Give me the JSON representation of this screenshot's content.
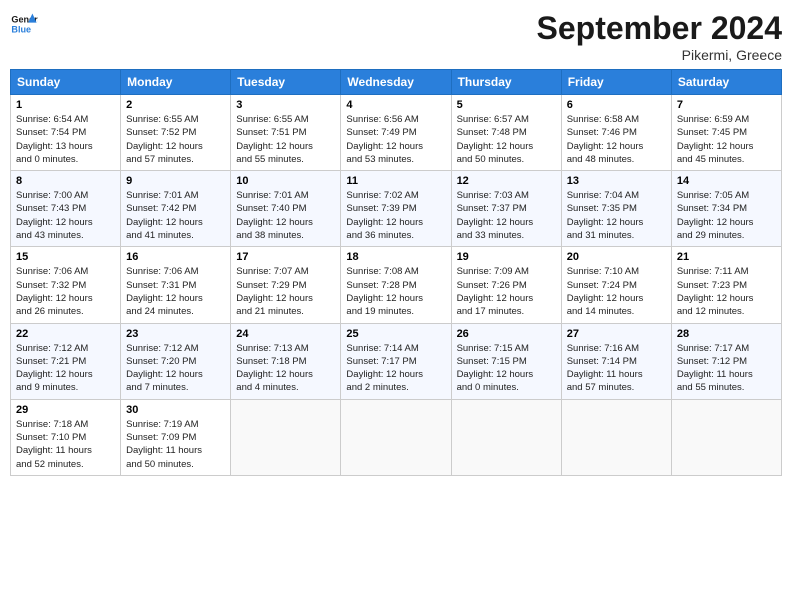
{
  "header": {
    "logo_general": "General",
    "logo_blue": "Blue",
    "month_title": "September 2024",
    "subtitle": "Pikermi, Greece"
  },
  "days_of_week": [
    "Sunday",
    "Monday",
    "Tuesday",
    "Wednesday",
    "Thursday",
    "Friday",
    "Saturday"
  ],
  "weeks": [
    [
      {
        "day": "1",
        "info": "Sunrise: 6:54 AM\nSunset: 7:54 PM\nDaylight: 13 hours\nand 0 minutes."
      },
      {
        "day": "2",
        "info": "Sunrise: 6:55 AM\nSunset: 7:52 PM\nDaylight: 12 hours\nand 57 minutes."
      },
      {
        "day": "3",
        "info": "Sunrise: 6:55 AM\nSunset: 7:51 PM\nDaylight: 12 hours\nand 55 minutes."
      },
      {
        "day": "4",
        "info": "Sunrise: 6:56 AM\nSunset: 7:49 PM\nDaylight: 12 hours\nand 53 minutes."
      },
      {
        "day": "5",
        "info": "Sunrise: 6:57 AM\nSunset: 7:48 PM\nDaylight: 12 hours\nand 50 minutes."
      },
      {
        "day": "6",
        "info": "Sunrise: 6:58 AM\nSunset: 7:46 PM\nDaylight: 12 hours\nand 48 minutes."
      },
      {
        "day": "7",
        "info": "Sunrise: 6:59 AM\nSunset: 7:45 PM\nDaylight: 12 hours\nand 45 minutes."
      }
    ],
    [
      {
        "day": "8",
        "info": "Sunrise: 7:00 AM\nSunset: 7:43 PM\nDaylight: 12 hours\nand 43 minutes."
      },
      {
        "day": "9",
        "info": "Sunrise: 7:01 AM\nSunset: 7:42 PM\nDaylight: 12 hours\nand 41 minutes."
      },
      {
        "day": "10",
        "info": "Sunrise: 7:01 AM\nSunset: 7:40 PM\nDaylight: 12 hours\nand 38 minutes."
      },
      {
        "day": "11",
        "info": "Sunrise: 7:02 AM\nSunset: 7:39 PM\nDaylight: 12 hours\nand 36 minutes."
      },
      {
        "day": "12",
        "info": "Sunrise: 7:03 AM\nSunset: 7:37 PM\nDaylight: 12 hours\nand 33 minutes."
      },
      {
        "day": "13",
        "info": "Sunrise: 7:04 AM\nSunset: 7:35 PM\nDaylight: 12 hours\nand 31 minutes."
      },
      {
        "day": "14",
        "info": "Sunrise: 7:05 AM\nSunset: 7:34 PM\nDaylight: 12 hours\nand 29 minutes."
      }
    ],
    [
      {
        "day": "15",
        "info": "Sunrise: 7:06 AM\nSunset: 7:32 PM\nDaylight: 12 hours\nand 26 minutes."
      },
      {
        "day": "16",
        "info": "Sunrise: 7:06 AM\nSunset: 7:31 PM\nDaylight: 12 hours\nand 24 minutes."
      },
      {
        "day": "17",
        "info": "Sunrise: 7:07 AM\nSunset: 7:29 PM\nDaylight: 12 hours\nand 21 minutes."
      },
      {
        "day": "18",
        "info": "Sunrise: 7:08 AM\nSunset: 7:28 PM\nDaylight: 12 hours\nand 19 minutes."
      },
      {
        "day": "19",
        "info": "Sunrise: 7:09 AM\nSunset: 7:26 PM\nDaylight: 12 hours\nand 17 minutes."
      },
      {
        "day": "20",
        "info": "Sunrise: 7:10 AM\nSunset: 7:24 PM\nDaylight: 12 hours\nand 14 minutes."
      },
      {
        "day": "21",
        "info": "Sunrise: 7:11 AM\nSunset: 7:23 PM\nDaylight: 12 hours\nand 12 minutes."
      }
    ],
    [
      {
        "day": "22",
        "info": "Sunrise: 7:12 AM\nSunset: 7:21 PM\nDaylight: 12 hours\nand 9 minutes."
      },
      {
        "day": "23",
        "info": "Sunrise: 7:12 AM\nSunset: 7:20 PM\nDaylight: 12 hours\nand 7 minutes."
      },
      {
        "day": "24",
        "info": "Sunrise: 7:13 AM\nSunset: 7:18 PM\nDaylight: 12 hours\nand 4 minutes."
      },
      {
        "day": "25",
        "info": "Sunrise: 7:14 AM\nSunset: 7:17 PM\nDaylight: 12 hours\nand 2 minutes."
      },
      {
        "day": "26",
        "info": "Sunrise: 7:15 AM\nSunset: 7:15 PM\nDaylight: 12 hours\nand 0 minutes."
      },
      {
        "day": "27",
        "info": "Sunrise: 7:16 AM\nSunset: 7:14 PM\nDaylight: 11 hours\nand 57 minutes."
      },
      {
        "day": "28",
        "info": "Sunrise: 7:17 AM\nSunset: 7:12 PM\nDaylight: 11 hours\nand 55 minutes."
      }
    ],
    [
      {
        "day": "29",
        "info": "Sunrise: 7:18 AM\nSunset: 7:10 PM\nDaylight: 11 hours\nand 52 minutes."
      },
      {
        "day": "30",
        "info": "Sunrise: 7:19 AM\nSunset: 7:09 PM\nDaylight: 11 hours\nand 50 minutes."
      },
      {
        "day": "",
        "info": ""
      },
      {
        "day": "",
        "info": ""
      },
      {
        "day": "",
        "info": ""
      },
      {
        "day": "",
        "info": ""
      },
      {
        "day": "",
        "info": ""
      }
    ]
  ]
}
